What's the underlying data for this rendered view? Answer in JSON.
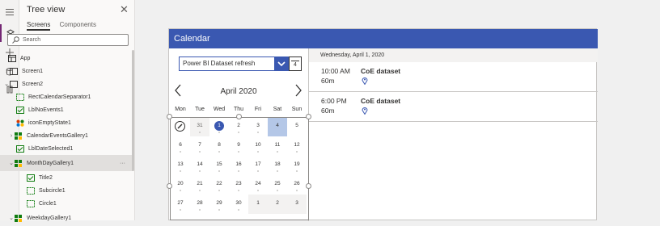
{
  "left_rail": {
    "icons": [
      "hamburger-icon",
      "layers-icon",
      "plus-icon",
      "database-icon",
      "advanced-tools-icon"
    ]
  },
  "tree_panel": {
    "title": "Tree view",
    "tabs": [
      {
        "label": "Screens",
        "selected": true
      },
      {
        "label": "Components",
        "selected": false
      }
    ],
    "search": {
      "placeholder": "Search"
    },
    "items": [
      {
        "label": "App",
        "icon": "app-icon",
        "indent": 0,
        "expand": ""
      },
      {
        "label": "Screen1",
        "icon": "screen-icon",
        "indent": 0,
        "expand": "›"
      },
      {
        "label": "Screen2",
        "icon": "screen-icon",
        "indent": 0,
        "expand": "⌄"
      },
      {
        "label": "RectCalendarSeparator1",
        "icon": "rectangle-icon",
        "indent": 1,
        "expand": ""
      },
      {
        "label": "LblNoEvents1",
        "icon": "label-icon",
        "indent": 1,
        "expand": ""
      },
      {
        "label": "iconEmptyState1",
        "icon": "icons-icon",
        "indent": 1,
        "expand": ""
      },
      {
        "label": "CalendarEventsGallery1",
        "icon": "gallery-icon",
        "indent": 1,
        "expand": "›"
      },
      {
        "label": "LblDateSelected1",
        "icon": "label-icon",
        "indent": 1,
        "expand": ""
      },
      {
        "label": "MonthDayGallery1",
        "icon": "gallery-icon",
        "indent": 1,
        "expand": "⌄",
        "selected": true,
        "more": "···"
      },
      {
        "label": "Title2",
        "icon": "label-icon",
        "indent": 2,
        "expand": ""
      },
      {
        "label": "Subcircle1",
        "icon": "shape-icon",
        "indent": 2,
        "expand": ""
      },
      {
        "label": "Circle1",
        "icon": "shape-icon",
        "indent": 2,
        "expand": ""
      },
      {
        "label": "WeekdayGallery1",
        "icon": "gallery-icon",
        "indent": 1,
        "expand": "⌄"
      }
    ]
  },
  "app": {
    "header_title": "Calendar",
    "dropdown_value": "Power BI Dataset refresh",
    "calendar_icon_day": "4",
    "month_label": "April 2020",
    "weekdays": [
      "Mon",
      "Tue",
      "Wed",
      "Thu",
      "Fri",
      "Sat",
      "Sun"
    ],
    "weeks": [
      [
        "",
        "31",
        "1",
        "2",
        "3",
        "4",
        "5"
      ],
      [
        "6",
        "7",
        "8",
        "9",
        "10",
        "11",
        "12"
      ],
      [
        "13",
        "14",
        "15",
        "16",
        "17",
        "18",
        "19"
      ],
      [
        "20",
        "21",
        "22",
        "23",
        "24",
        "25",
        "26"
      ],
      [
        "27",
        "28",
        "29",
        "30",
        "1",
        "2",
        "3"
      ]
    ],
    "selected_date_label": "Wednesday, April 1, 2020",
    "events": [
      {
        "time": "10:00 AM",
        "duration": "60m",
        "title": "CoE dataset"
      },
      {
        "time": "6:00 PM",
        "duration": "60m",
        "title": "CoE dataset"
      }
    ]
  },
  "colors": {
    "accent": "#3a58b1",
    "selected_day": "#b4c7e7"
  }
}
